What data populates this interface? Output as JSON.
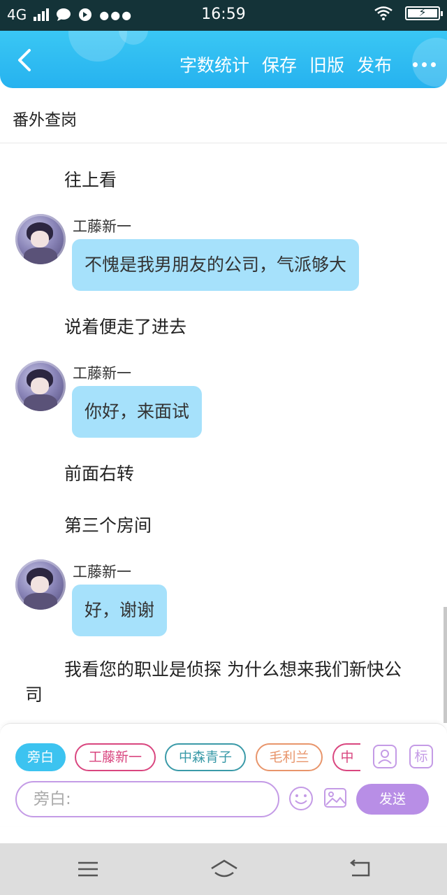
{
  "status_bar": {
    "network": "4G",
    "time": "16:59"
  },
  "header": {
    "actions": [
      "字数统计",
      "保存",
      "旧版",
      "发布"
    ]
  },
  "title": "番外查岗",
  "messages": [
    {
      "type": "narration",
      "text": "往上看"
    },
    {
      "type": "dialogue",
      "speaker": "工藤新一",
      "text": "不愧是我男朋友的公司，气派够大"
    },
    {
      "type": "narration",
      "text": "说着便走了进去"
    },
    {
      "type": "dialogue",
      "speaker": "工藤新一",
      "text": "你好，来面试"
    },
    {
      "type": "narration",
      "text": "前面右转"
    },
    {
      "type": "narration",
      "text": "第三个房间"
    },
    {
      "type": "dialogue",
      "speaker": "工藤新一",
      "text": "好，谢谢"
    },
    {
      "type": "narration",
      "text": "我看您的职业是侦探 为什么想来我们新快公司"
    }
  ],
  "composer": {
    "chips": [
      {
        "label": "旁白",
        "color": "#3cc3f0",
        "selected": true
      },
      {
        "label": "工藤新一",
        "color": "#d9467f",
        "selected": false
      },
      {
        "label": "中森青子",
        "color": "#3a9aa8",
        "selected": false
      },
      {
        "label": "毛利兰",
        "color": "#e8956b",
        "selected": false
      },
      {
        "label": "中",
        "color": "#d9467f",
        "selected": false
      }
    ],
    "tool_label": "标",
    "input_placeholder": "旁白:",
    "send_label": "发送"
  },
  "colors": {
    "header": "#2fbaf2",
    "bubble": "#a6e1fb",
    "accent": "#b88ee6"
  }
}
